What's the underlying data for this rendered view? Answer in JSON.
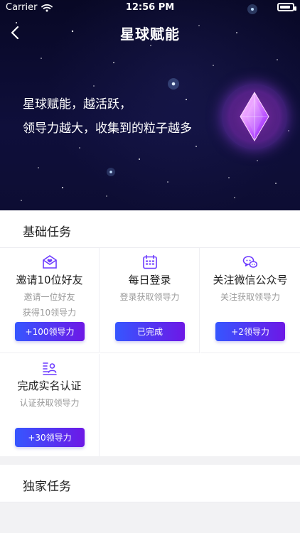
{
  "status_bar": {
    "carrier": "Carrier",
    "time": "12:56 PM",
    "wifi_icon": "wifi-icon",
    "battery_icon": "battery-icon",
    "battery_level": 0.85
  },
  "navbar": {
    "back_icon": "back-icon",
    "title": "星球赋能"
  },
  "hero": {
    "line1": "星球赋能，越活跃，",
    "line2": "领导力越大，收集到的粒子越多",
    "gem_icon": "gem-icon"
  },
  "sections": {
    "basic": "基础任务",
    "exclusive": "独家任务"
  },
  "tasks": [
    {
      "name": "invite",
      "icon": "invite-mail-icon",
      "title": "邀请10位好友",
      "sub1": "邀请一位好友",
      "sub2": "获得10领导力",
      "button": "+100领导力"
    },
    {
      "name": "daily-login",
      "icon": "calendar-icon",
      "title": "每日登录",
      "sub1": "登录获取领导力",
      "sub2": "",
      "button": "已完成"
    },
    {
      "name": "wechat",
      "icon": "wechat-icon",
      "title": "关注微信公众号",
      "sub1": "关注获取领导力",
      "sub2": "",
      "button": "+2领导力"
    },
    {
      "name": "real-name",
      "icon": "id-card-icon",
      "title": "完成实名认证",
      "sub1": "认证获取领导力",
      "sub2": "",
      "button": "+30领导力"
    }
  ],
  "colors": {
    "button_gradient_start": "#3656FF",
    "button_gradient_end": "#6D18E6",
    "hero_bg": "#0B0B2F",
    "icon_accent": "#6D3BFF"
  }
}
